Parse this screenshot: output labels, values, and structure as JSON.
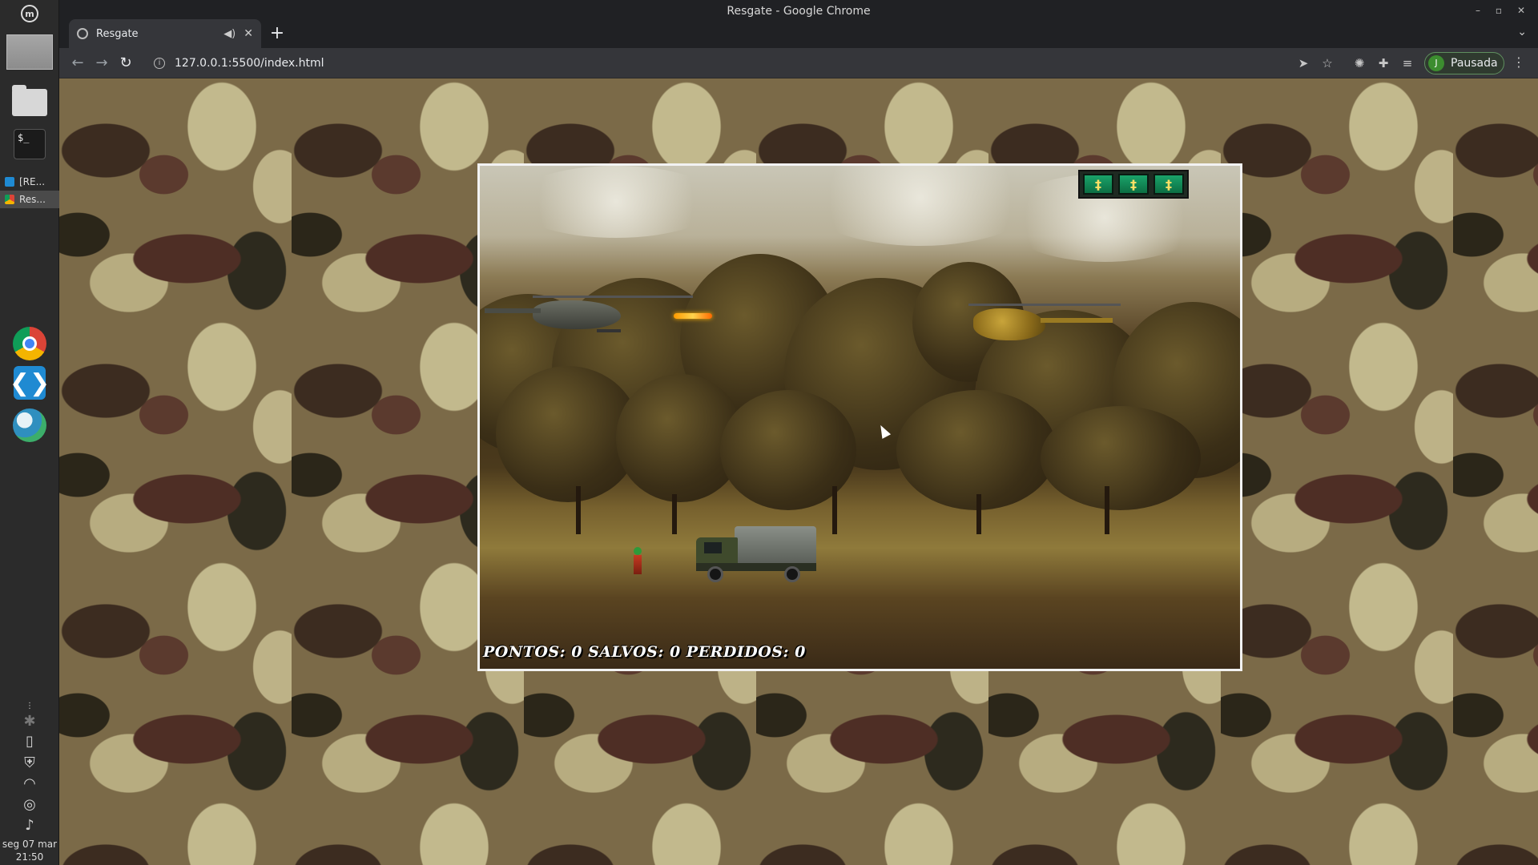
{
  "window": {
    "title": "Resgate - Google Chrome"
  },
  "tab": {
    "title": "Resgate"
  },
  "address_bar": {
    "url": "127.0.0.1:5500/index.html"
  },
  "profile": {
    "initial": "J",
    "status": "Pausada"
  },
  "dock": {
    "tasks": [
      {
        "label": "[RE...",
        "icon": "vscode-icon"
      },
      {
        "label": "Res...",
        "icon": "chrome-icon"
      }
    ],
    "clock_date": "seg 07 mar",
    "clock_time": "21:50"
  },
  "game": {
    "score_text": "PONTOS: 0 SALVOS: 0 PERDIDOS: 0",
    "lives": [
      {
        "icon": "soldier-life-icon",
        "glyph": "‡"
      },
      {
        "icon": "soldier-life-icon",
        "glyph": "‡"
      },
      {
        "icon": "soldier-life-icon",
        "glyph": "‡"
      }
    ]
  },
  "colors": {
    "chrome_dark": "#202124",
    "chrome_toolbar": "#35363a",
    "profile_green": "#3c8d2f",
    "life_green": "#1aa36a"
  }
}
